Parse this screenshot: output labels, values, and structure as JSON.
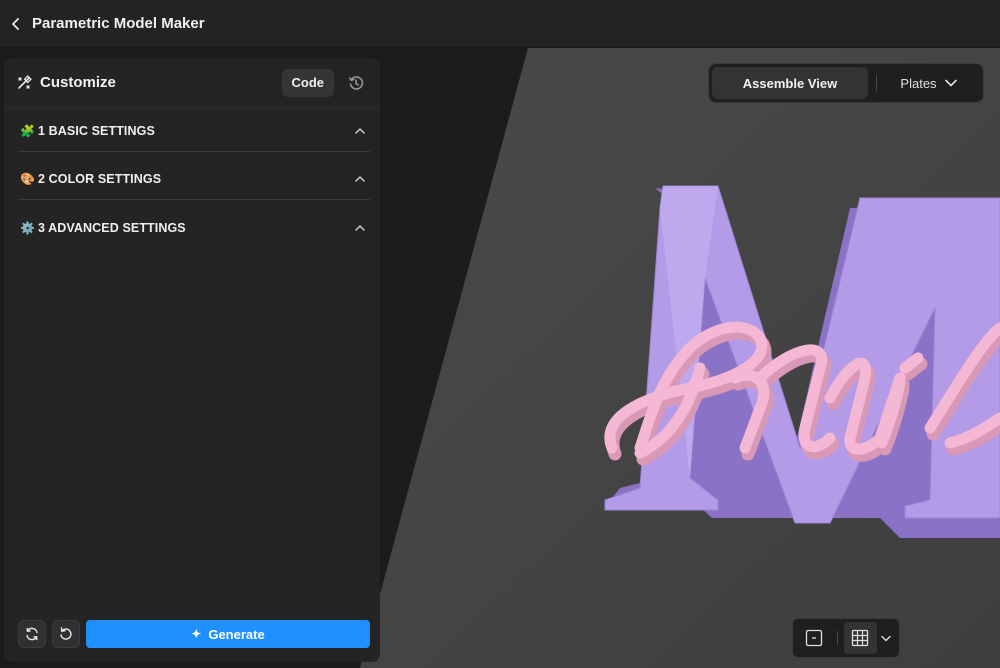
{
  "app": {
    "title": "Parametric Model Maker"
  },
  "panel": {
    "title": "Customize",
    "code_label": "Code",
    "sections": [
      {
        "emoji": "🧩",
        "label": "1 BASIC SETTINGS"
      },
      {
        "emoji": "🎨",
        "label": "2 COLOR SETTINGS"
      },
      {
        "emoji": "⚙️",
        "label": "3 ADVANCED SETTINGS"
      }
    ],
    "generate_label": "Generate"
  },
  "viewport": {
    "view_label": "Assemble View",
    "plates_label": "Plates",
    "model_letter": "M",
    "model_script": "Mil",
    "letter_color": "#b39be8",
    "script_color": "#f5b8d4"
  },
  "colors": {
    "accent": "#1e90ff",
    "background": "#1b1b1b",
    "panel": "#242424"
  }
}
